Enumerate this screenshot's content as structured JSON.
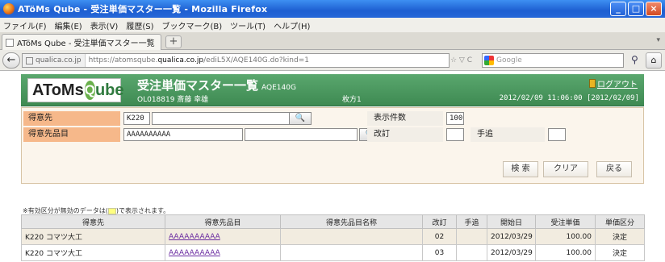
{
  "window": {
    "title": "ATöMs Qube - 受注単価マスター一覧 - Mozilla Firefox",
    "controls": [
      "_",
      "□",
      "×"
    ]
  },
  "menu": [
    "ファイル(F)",
    "編集(E)",
    "表示(V)",
    "履歴(S)",
    "ブックマーク(B)",
    "ツール(T)",
    "ヘルプ(H)"
  ],
  "tab": {
    "label": "ATöMs Qube - 受注単価マスター一覧",
    "new_tab": "+"
  },
  "nav": {
    "back": "←",
    "site": "qualica.co.jp",
    "url_prefix": "https://atomsqube.",
    "url_domain": "qualica.co.jp",
    "url_suffix": "/ediL5X/AQE140G.do?kind=1",
    "url_controls": "☆ ▽ C",
    "search_placeholder": "Google",
    "search_icon": "⚲",
    "home_icon": "⌂"
  },
  "app": {
    "logo_prefix": "AToMs",
    "logo_q": "Q",
    "logo_suffix": "ube",
    "title": "受注単価マスター一覧",
    "screen_code": "AQE140G",
    "user": "OL018819 斎藤 幸雄",
    "branch": "枚方1",
    "logout": "ログアウト",
    "datetime": "2012/02/09 11:06:00 [2012/02/09]"
  },
  "filter": {
    "customer_label": "得意先",
    "customer_value": "K220",
    "customer_item_label": "得意先品目",
    "customer_item_value": "AAAAAAAAAA",
    "display_count_label": "表示件数",
    "display_count_value": "100",
    "revision_label": "改訂",
    "revision_value": "",
    "suffix_label": "手追",
    "suffix_value": "",
    "lookup_icon": "🔍",
    "search_button": "検 索",
    "clear_button": "クリア",
    "back_button": "戻る"
  },
  "note": {
    "before": "※有効区分が無効のデータは(",
    "after": ")で表示されます。"
  },
  "table": {
    "headers": [
      "得意先",
      "得意先品目",
      "得意先品目名称",
      "改訂",
      "手追",
      "開始日",
      "受注単価",
      "単価区分"
    ],
    "rows": [
      [
        "K220 コマツ大工",
        "AAAAAAAAAA",
        "",
        "02",
        "",
        "2012/03/29",
        "100.00",
        "決定"
      ],
      [
        "K220 コマツ大工",
        "AAAAAAAAAA",
        "",
        "03",
        "",
        "2012/03/29",
        "100.00",
        "決定"
      ]
    ]
  }
}
